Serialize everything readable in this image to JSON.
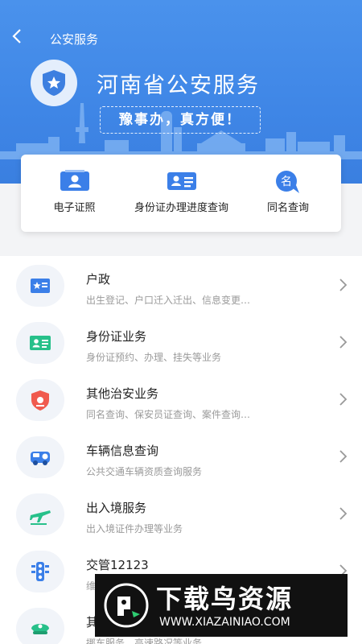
{
  "nav": {
    "title": "公安服务"
  },
  "hero": {
    "title": "河南省公安服务",
    "slogan": "豫事办，真方便！"
  },
  "quick_actions": [
    {
      "label": "电子证照",
      "icon": "photo-id-card-icon"
    },
    {
      "label": "身份证办理进度查询",
      "icon": "id-card-icon"
    },
    {
      "label": "同名查询",
      "icon": "name-search-icon"
    }
  ],
  "services": [
    {
      "title": "户政",
      "subtitle": "出生登记、户口迁入迁出、信息变更…",
      "icon": "household-register-icon"
    },
    {
      "title": "身份证业务",
      "subtitle": "身份证预约、办理、挂失等业务",
      "icon": "id-card-icon"
    },
    {
      "title": "其他治安业务",
      "subtitle": "同名查询、保安员证查询、案件查询…",
      "icon": "police-shield-icon"
    },
    {
      "title": "车辆信息查询",
      "subtitle": "公共交通车辆资质查询服务",
      "icon": "vehicle-icon"
    },
    {
      "title": "出入境服务",
      "subtitle": "出入境证件办理等业务",
      "icon": "airplane-icon"
    },
    {
      "title": "交管12123",
      "subtitle": "维",
      "icon": "traffic-light-icon"
    },
    {
      "title": "其",
      "subtitle": "挪车服务、高速路况等业务",
      "icon": "police-cap-icon"
    }
  ],
  "watermark": {
    "brand": "下载鸟资源",
    "url": "WWW.XIAZAINIAO.COM"
  },
  "colors": {
    "primary": "#3f86e6",
    "icon_blue": "#3b7fe8",
    "icon_red": "#f05a4e",
    "icon_green": "#27c08a"
  }
}
